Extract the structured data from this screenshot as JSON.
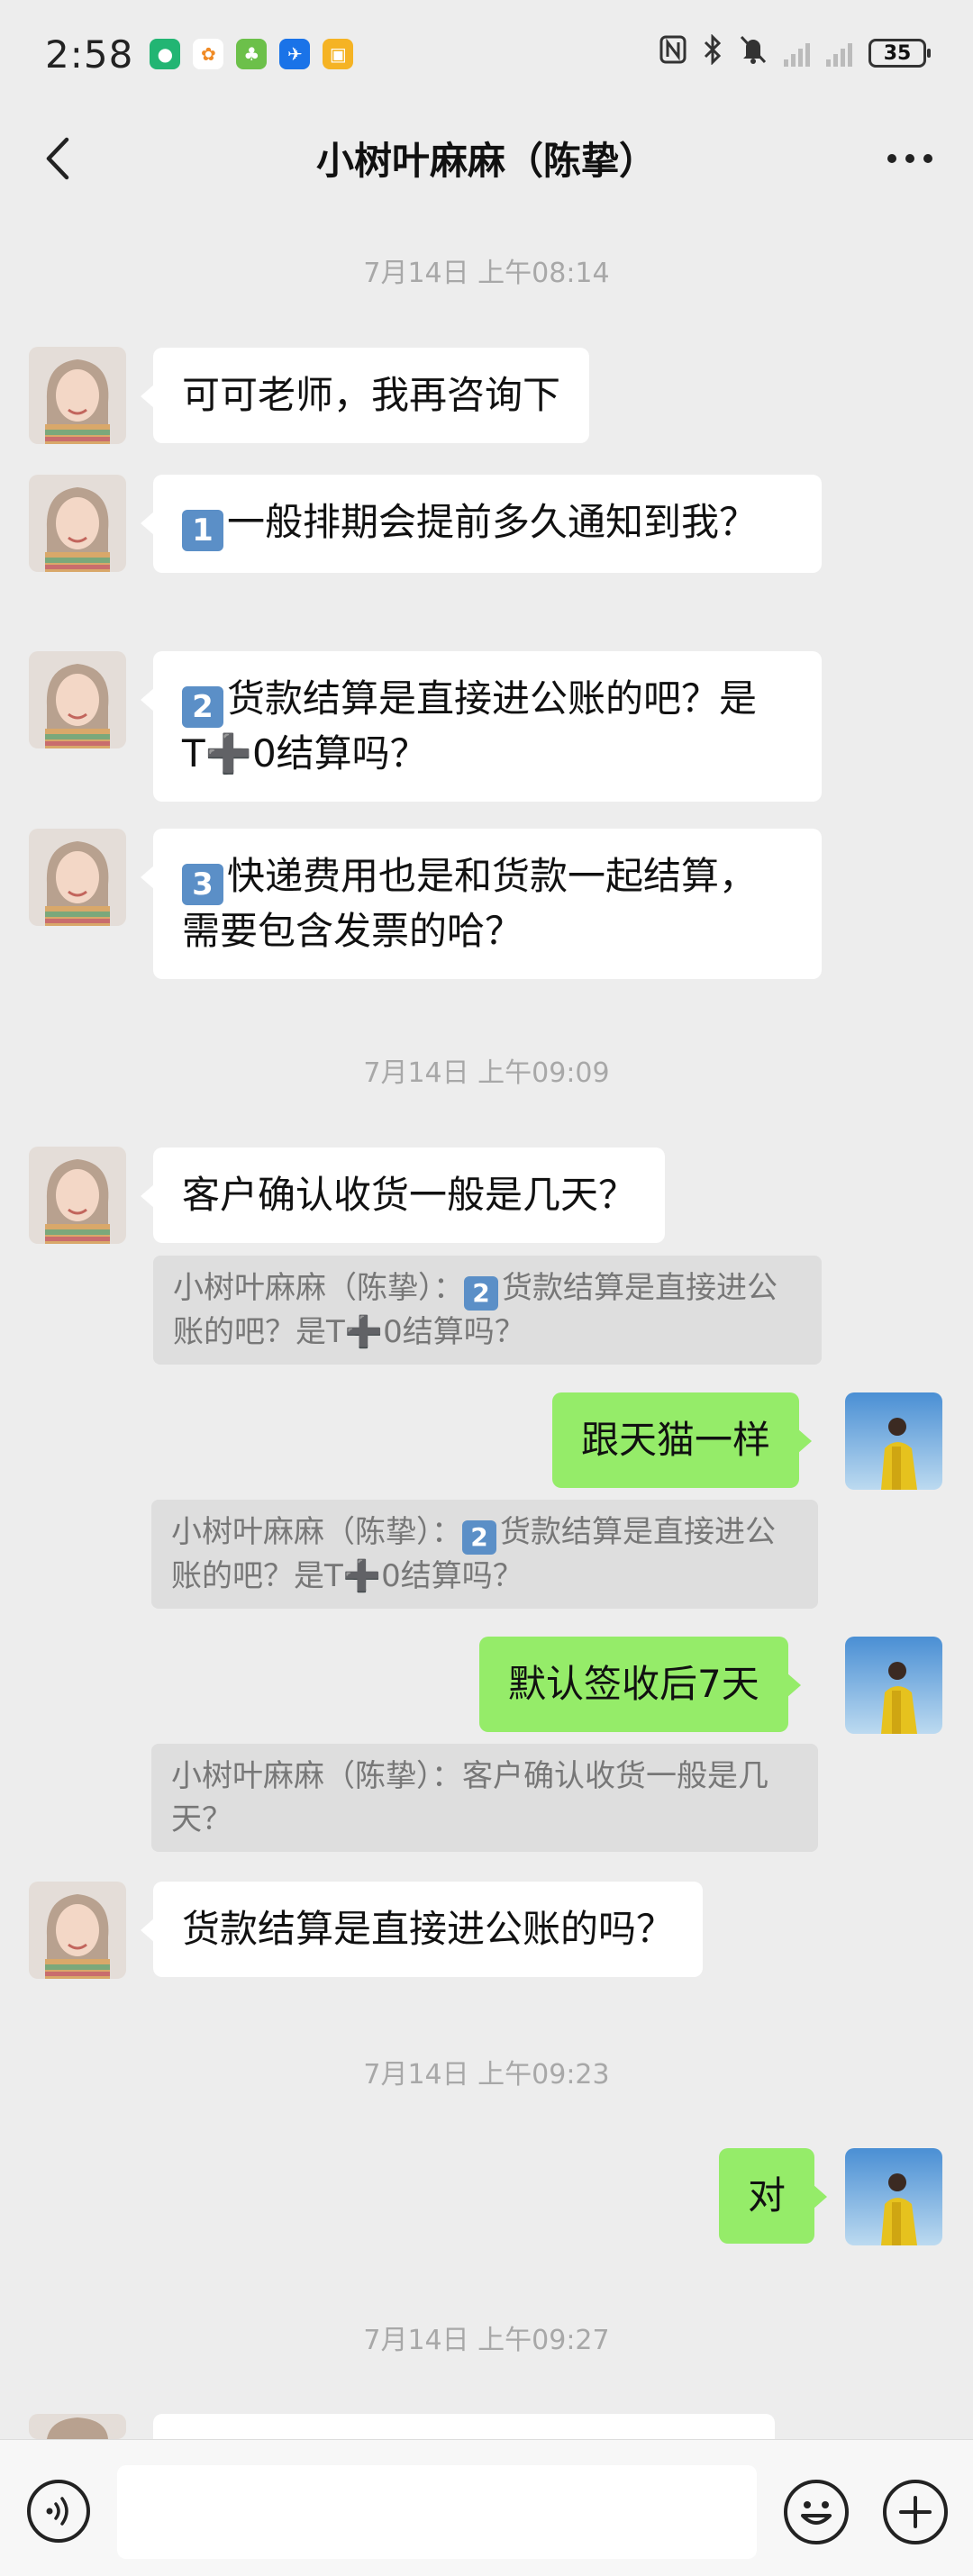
{
  "status_bar": {
    "time": "2:58",
    "battery": "35",
    "app_icons": [
      "maps-app-icon",
      "taobao-app-icon",
      "lifestyle-app-icon",
      "flight-app-icon",
      "wallet-app-icon"
    ],
    "app_icon_colors": [
      "#22b573",
      "#ffffff",
      "#6cc04a",
      "#1a73e8",
      "#f5b324"
    ]
  },
  "header": {
    "title": "小树叶麻麻（陈挚）"
  },
  "messages": [
    {
      "type": "timestamp",
      "text": "7月14日 上午08:14"
    },
    {
      "type": "text",
      "side": "left",
      "text": "可可老师，我再咨询下"
    },
    {
      "type": "text",
      "side": "left",
      "badge": "1",
      "text": "一般排期会提前多久通知到我？"
    },
    {
      "type": "text",
      "side": "left",
      "badge": "2",
      "text": "货款结算是直接进公账的吧？是T➕0结算吗？"
    },
    {
      "type": "text",
      "side": "left",
      "badge": "3",
      "text": "快递费用也是和货款一起结算，需要包含发票的哈？"
    },
    {
      "type": "timestamp",
      "text": "7月14日 上午09:09"
    },
    {
      "type": "text",
      "side": "left",
      "text": "客户确认收货一般是几天？"
    },
    {
      "type": "quote",
      "prefix": "小树叶麻麻（陈挚）：",
      "badge": "2",
      "text": "货款结算是直接进公账的吧？是T➕0结算吗？"
    },
    {
      "type": "text",
      "side": "right",
      "text": "跟天猫一样"
    },
    {
      "type": "quote",
      "prefix": "小树叶麻麻（陈挚）：",
      "badge": "2",
      "text": "货款结算是直接进公账的吧？是T➕0结算吗？"
    },
    {
      "type": "text",
      "side": "right",
      "text": "默认签收后7天"
    },
    {
      "type": "quote",
      "prefix": "小树叶麻麻（陈挚）：",
      "text": "客户确认收货一般是几天？"
    },
    {
      "type": "text",
      "side": "left",
      "text": "货款结算是直接进公账的吗？"
    },
    {
      "type": "timestamp",
      "text": "7月14日 上午09:23"
    },
    {
      "type": "text",
      "side": "right",
      "text": "对"
    },
    {
      "type": "timestamp",
      "text": "7月14日 上午09:27"
    }
  ],
  "input_bar": {
    "placeholder": ""
  },
  "colors": {
    "background": "#ededed",
    "bubble_left": "#ffffff",
    "bubble_right": "#95ec69",
    "quote_bg": "#dedede",
    "timestamp": "#a8a8a8",
    "badge": "#5b8fc7"
  }
}
